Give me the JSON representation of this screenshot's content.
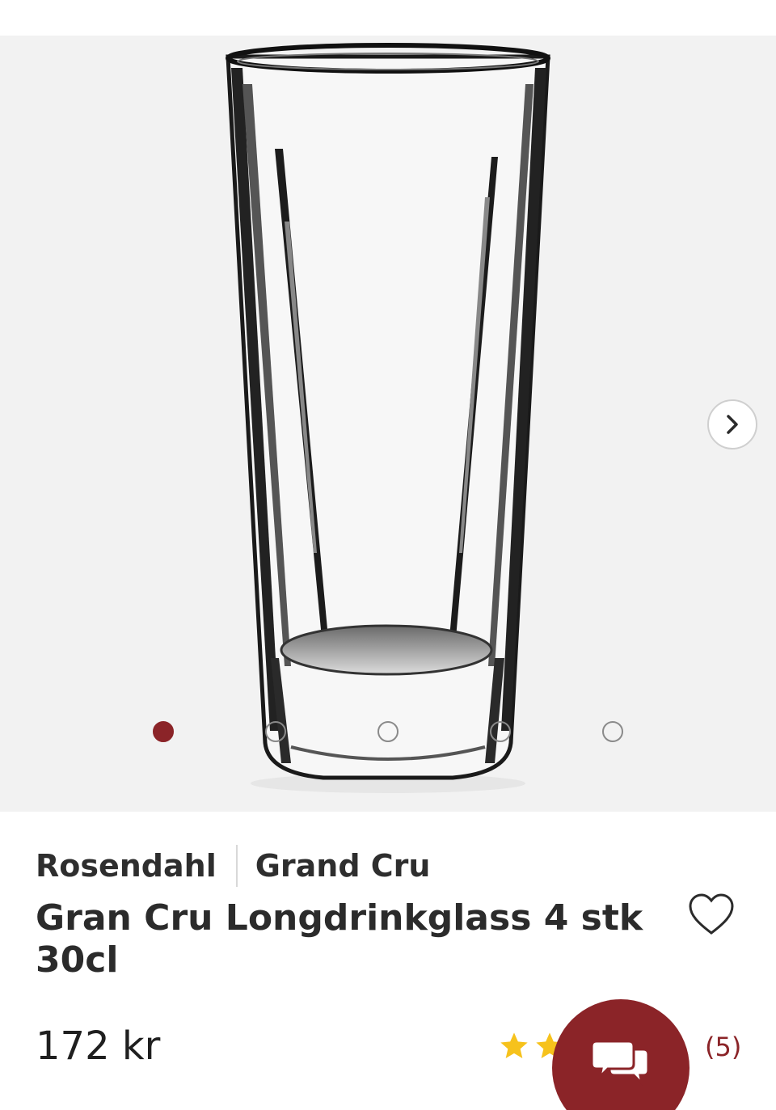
{
  "theme": {
    "accent": "#8b2428",
    "star_color": "#f6c21c"
  },
  "gallery": {
    "image_alt": "Gran Cru Longdrinkglass",
    "slide_count": 5,
    "active_slide": 1,
    "next_icon": "chevron-right-icon"
  },
  "product": {
    "brand": "Rosendahl",
    "collection": "Grand Cru",
    "title": "Gran Cru Longdrinkglass 4 stk 30cl",
    "price": "172 kr",
    "rating": {
      "stars_shown": 2,
      "review_count": "(5)"
    }
  },
  "icons": {
    "wishlist": "heart-outline-icon",
    "chat": "chat-bubbles-icon"
  }
}
